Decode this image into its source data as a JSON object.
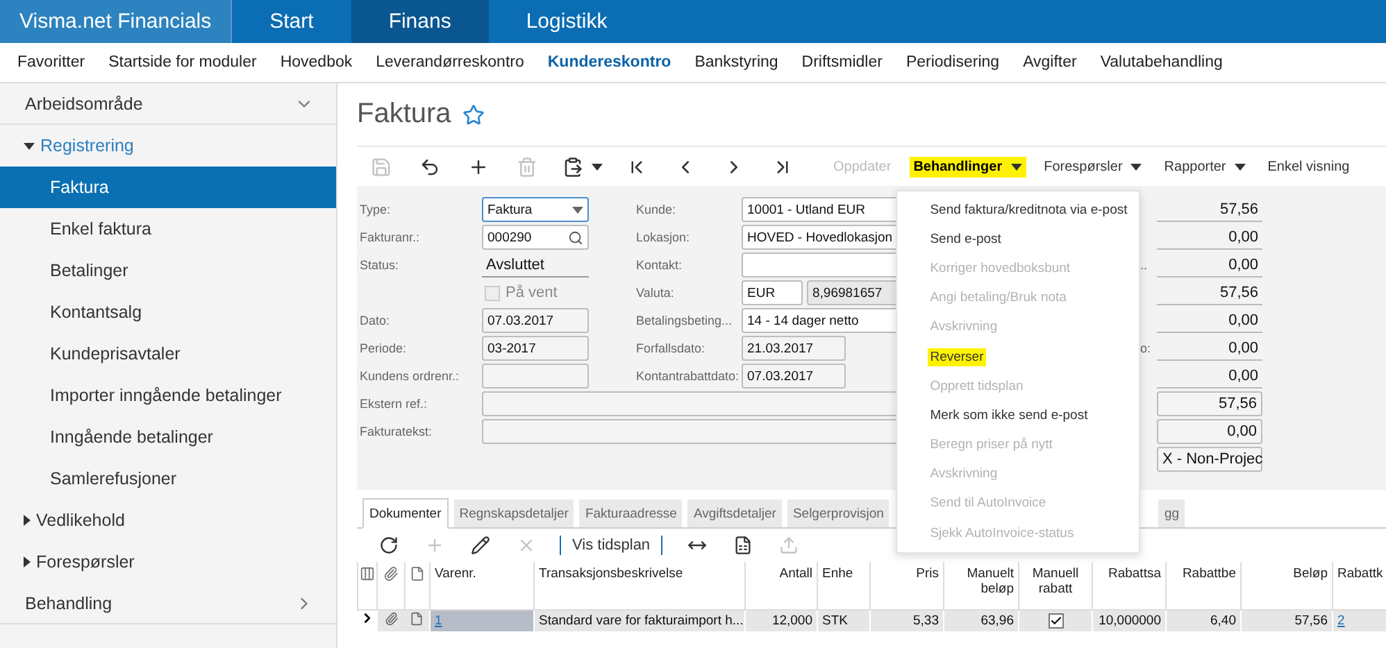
{
  "topbar": {
    "brand": "Visma.net Financials",
    "tabs": [
      {
        "label": "Start",
        "selected": false
      },
      {
        "label": "Finans",
        "selected": true
      },
      {
        "label": "Logistikk",
        "selected": false
      }
    ]
  },
  "menu": [
    {
      "label": "Favoritter",
      "selected": false
    },
    {
      "label": "Startside for moduler",
      "selected": false
    },
    {
      "label": "Hovedbok",
      "selected": false
    },
    {
      "label": "Leverandørreskontro",
      "selected": false
    },
    {
      "label": "Kundereskontro",
      "selected": true
    },
    {
      "label": "Bankstyring",
      "selected": false
    },
    {
      "label": "Driftsmidler",
      "selected": false
    },
    {
      "label": "Periodisering",
      "selected": false
    },
    {
      "label": "Avgifter",
      "selected": false
    },
    {
      "label": "Valutabehandling",
      "selected": false
    }
  ],
  "sidebar": {
    "sections": [
      {
        "label": "Arbeidsområde",
        "expanded": true,
        "groups": [
          {
            "label": "Registrering",
            "expanded": true,
            "children": [
              {
                "label": "Faktura",
                "selected": true
              },
              {
                "label": "Enkel faktura",
                "selected": false
              },
              {
                "label": "Betalinger",
                "selected": false
              },
              {
                "label": "Kontantsalg",
                "selected": false
              },
              {
                "label": "Kundeprisavtaler",
                "selected": false
              },
              {
                "label": "Importer inngående betalinger",
                "selected": false
              },
              {
                "label": "Inngående betalinger",
                "selected": false
              },
              {
                "label": "Samlerefusjoner",
                "selected": false
              }
            ]
          },
          {
            "label": "Vedlikehold",
            "expanded": false
          },
          {
            "label": "Forespørsler",
            "expanded": false
          }
        ]
      },
      {
        "label": "Behandling",
        "expanded": false
      }
    ]
  },
  "page": {
    "title": "Faktura"
  },
  "toolbar": {
    "buttons": [
      {
        "kind": "save",
        "disabled": true
      },
      {
        "kind": "undo",
        "disabled": false
      },
      {
        "kind": "add",
        "disabled": false
      },
      {
        "kind": "delete",
        "disabled": true
      },
      {
        "kind": "paste",
        "disabled": false
      },
      {
        "kind": "first",
        "disabled": false
      },
      {
        "kind": "prev",
        "disabled": false
      },
      {
        "kind": "next",
        "disabled": false
      },
      {
        "kind": "last",
        "disabled": false
      }
    ],
    "actions": [
      {
        "label": "Oppdater",
        "disabled": true,
        "dropdown": false,
        "highlighted": false
      },
      {
        "label": "Behandlinger",
        "disabled": false,
        "dropdown": true,
        "highlighted": true
      },
      {
        "label": "Forespørsler",
        "disabled": false,
        "dropdown": true,
        "highlighted": false
      },
      {
        "label": "Rapporter",
        "disabled": false,
        "dropdown": true,
        "highlighted": false
      },
      {
        "label": "Enkel visning",
        "disabled": false,
        "dropdown": false,
        "highlighted": false
      }
    ]
  },
  "action_menu": [
    {
      "label": "Send faktura/kreditnota via e-post",
      "disabled": false,
      "highlighted": false
    },
    {
      "label": "Send e-post",
      "disabled": false,
      "highlighted": false
    },
    {
      "label": "Korriger hovedboksbunt",
      "disabled": true,
      "highlighted": false
    },
    {
      "label": "Angi betaling/Bruk nota",
      "disabled": true,
      "highlighted": false
    },
    {
      "label": "Avskrivning",
      "disabled": true,
      "highlighted": false
    },
    {
      "label": "Reverser",
      "disabled": false,
      "highlighted": true
    },
    {
      "label": "Opprett tidsplan",
      "disabled": true,
      "highlighted": false
    },
    {
      "label": "Merk som ikke send e-post",
      "disabled": false,
      "highlighted": false
    },
    {
      "label": "Beregn priser på nytt",
      "disabled": true,
      "highlighted": false
    },
    {
      "label": "Avskrivning",
      "disabled": true,
      "highlighted": false
    },
    {
      "label": "Send til AutoInvoice",
      "disabled": true,
      "highlighted": false
    },
    {
      "label": "Sjekk AutoInvoice-status",
      "disabled": true,
      "highlighted": false
    }
  ],
  "form": {
    "left": [
      {
        "kind": "select",
        "label": "Type:",
        "value": "Faktura"
      },
      {
        "kind": "lookup",
        "label": "Fakturanr.:",
        "value": "000290"
      },
      {
        "kind": "status",
        "label": "Status:",
        "value": "Avsluttet"
      },
      {
        "kind": "checkbox",
        "label": "På vent",
        "checked": false
      },
      {
        "kind": "date",
        "label": "Dato:",
        "value": "07.03.2017"
      },
      {
        "kind": "date",
        "label": "Periode:",
        "value": "03-2017"
      },
      {
        "kind": "date",
        "label": "Kundens ordrenr.:"
      },
      {
        "kind": "wide",
        "label": "Ekstern ref.:"
      },
      {
        "kind": "wide",
        "label": "Fakturatekst:"
      }
    ],
    "middle": [
      {
        "kind": "text",
        "label": "Kunde:",
        "value": "10001 - Utland EUR"
      },
      {
        "kind": "text",
        "label": "Lokasjon:",
        "value": "HOVED - Hovedlokasjon"
      },
      {
        "kind": "text",
        "label": "Kontakt:"
      },
      {
        "kind": "currency",
        "label": "Valuta:",
        "value": "EUR",
        "rate": "8,96981657"
      },
      {
        "kind": "text",
        "label": "Betalingsbeting...",
        "value": "14 - 14 dager netto"
      },
      {
        "kind": "date",
        "label": "Forfallsdato:",
        "value": "21.03.2017"
      },
      {
        "kind": "date",
        "label": "Kontantrabattdato:",
        "value": "07.03.2017"
      }
    ],
    "summary": [
      {
        "kind": "plain",
        "value": "57,56"
      },
      {
        "kind": "plain",
        "value": "0,00"
      },
      {
        "kind": "plain",
        "label": "..",
        "value": "0,00"
      },
      {
        "kind": "plain",
        "value": "57,56"
      },
      {
        "kind": "plain",
        "value": "0,00"
      },
      {
        "kind": "plain",
        "label": "o:",
        "value": "0,00"
      },
      {
        "kind": "plain",
        "value": "0,00"
      },
      {
        "kind": "boxed",
        "value": "57,56"
      },
      {
        "kind": "boxed",
        "value": "0,00"
      },
      {
        "kind": "boxed",
        "value": "X - Non-Projec"
      }
    ]
  },
  "tabs": [
    {
      "label": "Dokumenter",
      "selected": true
    },
    {
      "label": "Regnskapsdetaljer",
      "selected": false
    },
    {
      "label": "Fakturaadresse",
      "selected": false
    },
    {
      "label": "Avgiftsdetaljer",
      "selected": false
    },
    {
      "label": "Selgerprovisjon",
      "selected": false
    },
    {
      "label": "gg",
      "selected": false
    }
  ],
  "grid_toolbar": [
    {
      "kind": "refresh",
      "disabled": false
    },
    {
      "kind": "add",
      "disabled": true
    },
    {
      "kind": "edit",
      "disabled": false
    },
    {
      "kind": "delete",
      "disabled": true
    },
    {
      "kind": "separator"
    },
    {
      "kind": "text",
      "label": "Vis tidsplan"
    },
    {
      "kind": "separator"
    },
    {
      "kind": "fit",
      "disabled": false
    },
    {
      "kind": "excel",
      "disabled": false
    },
    {
      "kind": "upload",
      "disabled": true
    }
  ],
  "table": {
    "columns": [
      {
        "label": "Varenr.",
        "kind": "text"
      },
      {
        "label": "Transaksjonsbeskrivelse",
        "kind": "text"
      },
      {
        "label": "Antall",
        "kind": "number"
      },
      {
        "label": "Enhe",
        "kind": "text"
      },
      {
        "label": "Pris",
        "kind": "number"
      },
      {
        "label": "Manuelt beløp",
        "kind": "number"
      },
      {
        "label": "Manuell rabatt",
        "kind": "check"
      },
      {
        "label": "Rabattsa",
        "kind": "number"
      },
      {
        "label": "Rabattbe",
        "kind": "number"
      },
      {
        "label": "Beløp",
        "kind": "number"
      },
      {
        "label": "Rabattk",
        "kind": "text"
      }
    ],
    "rows": [
      {
        "current": true,
        "cells": [
          {
            "kind": "link",
            "text": "1"
          },
          {
            "kind": "text",
            "text": "Standard vare for fakturaimport h..."
          },
          {
            "kind": "text",
            "text": "12,000"
          },
          {
            "kind": "text",
            "text": "STK"
          },
          {
            "kind": "text",
            "text": "5,33"
          },
          {
            "kind": "text",
            "text": "63,96"
          },
          {
            "kind": "check",
            "checked": true
          },
          {
            "kind": "text",
            "text": "10,000000"
          },
          {
            "kind": "text",
            "text": "6,40"
          },
          {
            "kind": "text",
            "text": "57,56"
          },
          {
            "kind": "link",
            "text": "2"
          }
        ]
      }
    ]
  }
}
